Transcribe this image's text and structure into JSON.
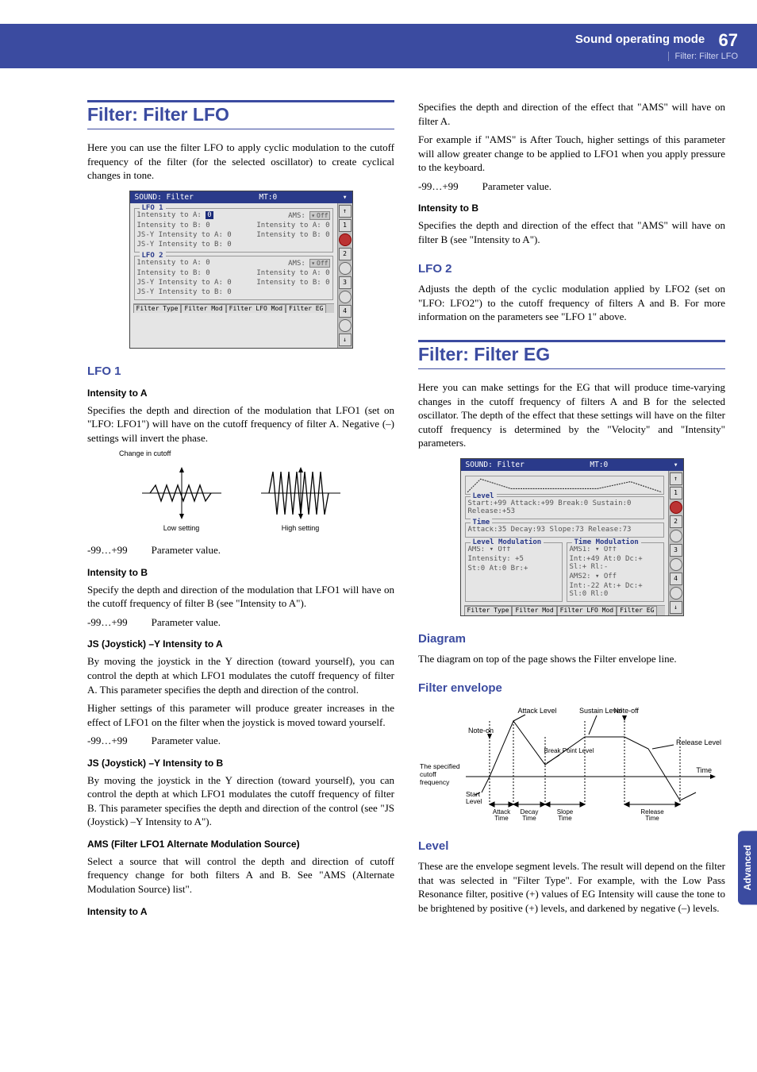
{
  "header": {
    "title": "Sound operating mode",
    "subtitle": "Filter: Filter LFO",
    "page": "67"
  },
  "sideTab": "Advanced",
  "sections": {
    "filterLFO": {
      "title": "Filter: Filter LFO",
      "intro": "Here you can use the filter LFO to apply cyclic modulation to the cutoff frequency of the filter (for the selected oscillator) to create cyclical changes in tone.",
      "screenshot": {
        "title": "SOUND: Filter",
        "mt": "MT:0",
        "lfo1": {
          "label": "LFO 1",
          "rows": [
            {
              "l": "Intensity to A:",
              "lv": "0",
              "r": "AMS:",
              "rv": "Off",
              "dd": true,
              "hv": true
            },
            {
              "l": "Intensity to B:",
              "lv": "0",
              "r": "Intensity to A:",
              "rv": "0"
            },
            {
              "l": "JS-Y Intensity to A:",
              "lv": "0",
              "r": "Intensity to B:",
              "rv": "0"
            },
            {
              "l": "JS-Y Intensity to B:",
              "lv": "0"
            }
          ]
        },
        "lfo2": {
          "label": "LFO 2",
          "rows": [
            {
              "l": "Intensity to A:",
              "lv": "0",
              "r": "AMS:",
              "rv": "Off",
              "dd": true
            },
            {
              "l": "Intensity to B:",
              "lv": "0",
              "r": "Intensity to A:",
              "rv": "0"
            },
            {
              "l": "JS-Y Intensity to A:",
              "lv": "0",
              "r": "Intensity to B:",
              "rv": "0"
            },
            {
              "l": "JS-Y Intensity to B:",
              "lv": "0"
            }
          ]
        },
        "tabs": [
          "Filter Type",
          "Filter Mod",
          "Filter LFO Mod",
          "Filter EG"
        ]
      },
      "lfo1": {
        "heading": "LFO 1",
        "intensityA": {
          "title": "Intensity to A",
          "body": "Specifies the depth and direction of the modulation that LFO1 (set on \"LFO: LFO1\") will have on the cutoff frequency of filter A. Negative (–) settings will invert the phase.",
          "range": "-99…+99",
          "rangeLabel": "Parameter value.",
          "cutoffLabel": "Change in cutoff",
          "lowLabel": "Low setting",
          "highLabel": "High setting"
        },
        "intensityB": {
          "title": "Intensity to B",
          "body": "Specify the depth and direction of the modulation that LFO1 will have on the cutoff frequency of filter B (see \"Intensity to A\").",
          "range": "-99…+99",
          "rangeLabel": "Parameter value."
        },
        "jsyA": {
          "title": "JS (Joystick) –Y Intensity to A",
          "body1": "By moving the joystick in the Y direction (toward yourself), you can control the depth at which LFO1 modulates the cutoff frequency of filter A. This parameter specifies the depth and direction of the control.",
          "body2": "Higher settings of this parameter will produce greater increases in the effect of LFO1 on the filter when the joystick is moved toward yourself.",
          "range": "-99…+99",
          "rangeLabel": "Parameter value."
        },
        "jsyB": {
          "title": "JS (Joystick) –Y Intensity to B",
          "body": "By moving the joystick in the Y direction (toward yourself), you can control the depth at which LFO1 modulates the cutoff frequency of filter B. This parameter specifies the depth and direction of the control (see \"JS (Joystick) –Y Intensity to A\")."
        },
        "ams": {
          "title": "AMS (Filter LFO1 Alternate Modulation Source)",
          "body": "Select a source that will control the depth and direction of cutoff frequency change for both filters A and B. See \"AMS (Alternate Modulation Source) list\"."
        },
        "amsIntA": {
          "title": "Intensity to A",
          "body1": "Specifies the depth and direction of the effect that \"AMS\" will have on filter A.",
          "body2": "For example if \"AMS\" is After Touch, higher settings of this parameter will allow greater change to be applied to LFO1 when you apply pressure to the keyboard.",
          "range": "-99…+99",
          "rangeLabel": "Parameter value."
        },
        "amsIntB": {
          "title": "Intensity to B",
          "body": "Specifies the depth and direction of the effect that \"AMS\" will have on filter B (see \"Intensity to A\")."
        }
      },
      "lfo2": {
        "heading": "LFO 2",
        "body": "Adjusts the depth of the cyclic modulation applied by LFO2 (set on \"LFO: LFO2\") to the cutoff frequency of filters A and B. For more information on the parameters see \"LFO 1\" above."
      }
    },
    "filterEG": {
      "title": "Filter: Filter EG",
      "intro": "Here you can make settings for the EG that will produce time-varying changes in the cutoff frequency of filters A and B for the selected oscillator. The depth of the effect that these settings will have on the filter cutoff frequency is determined by the \"Velocity\" and \"Intensity\" parameters.",
      "screenshot": {
        "title": "SOUND: Filter",
        "mt": "MT:0",
        "levelRow": "Start:+99 Attack:+99 Break:0   Sustain:0   Release:+53",
        "timeRow": "Attack:35  Decay:93   Slope:73   Release:73",
        "levelMod": {
          "label": "Level Modulation",
          "rows": [
            "AMS: ▾ Off",
            "Intensity: +5",
            "St:0  At:0  Br:+"
          ]
        },
        "timeMod": {
          "label": "Time Modulation",
          "rows": [
            "AMS1: ▾ Off",
            "Int:+49 At:0 Dc:+ Sl:+ Rl:-",
            "AMS2: ▾ Off",
            "Int:-22 At:+ Dc:+ Sl:0 Rl:0"
          ]
        },
        "tabs": [
          "Filter Type",
          "Filter Mod",
          "Filter LFO Mod",
          "Filter EG"
        ]
      },
      "diagram": {
        "heading": "Diagram",
        "body": "The diagram on top of the page shows the Filter envelope line."
      },
      "envelope": {
        "heading": "Filter envelope",
        "labels": {
          "noteOn": "Note-on",
          "noteOff": "Note-off",
          "attackLevel": "Attack Level",
          "sustainLevel": "Sustain Level",
          "releaseLevel": "Release Level",
          "breakPoint": "Break Point Level",
          "specified": "The specified cutoff frequency",
          "startLevel": "Start Level",
          "attackTime": "Attack Time",
          "decayTime": "Decay Time",
          "slopeTime": "Slope Time",
          "releaseTime": "Release Time",
          "time": "Time"
        }
      },
      "level": {
        "heading": "Level",
        "body": "These are the envelope segment levels. The result will depend on the filter that was selected in \"Filter Type\". For example, with the Low Pass Resonance filter, positive (+) values of EG Intensity will cause the tone to be brightened by positive (+) levels, and darkened by negative (–) levels."
      }
    }
  }
}
